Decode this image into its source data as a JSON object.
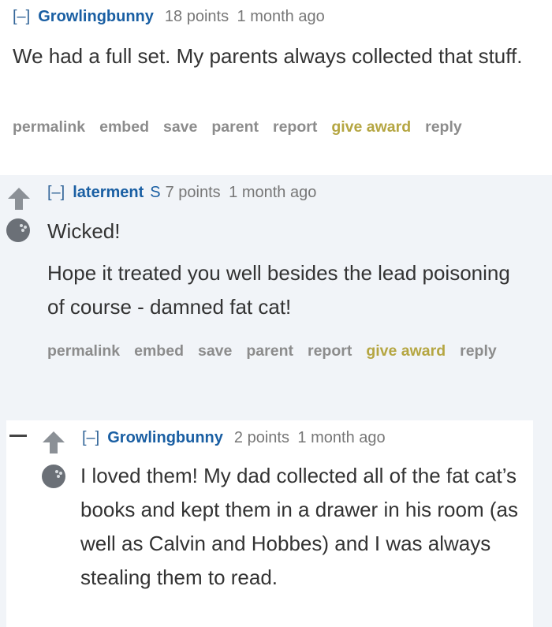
{
  "comments": [
    {
      "toggle": "[–]",
      "author": "Growlingbunny",
      "points": "18 points",
      "age": "1 month ago",
      "paragraphs": [
        "We had a full set. My parents always collected that stuff."
      ]
    },
    {
      "toggle": "[–]",
      "author": "laterment",
      "submitter_tag": "S",
      "points": "7 points",
      "age": "1 month ago",
      "paragraphs": [
        "Wicked!",
        "Hope it treated you well besides the lead poisoning of course - damned fat cat!"
      ]
    },
    {
      "toggle": "[–]",
      "author": "Growlingbunny",
      "points": "2 points",
      "age": "1 month ago",
      "paragraphs": [
        "I loved them! My dad collected all of the fat cat’s books and kept them in a drawer in his room (as well as Calvin and Hobbes) and I was always stealing them to read."
      ]
    }
  ],
  "actions": {
    "permalink": "permalink",
    "embed": "embed",
    "save": "save",
    "parent": "parent",
    "report": "report",
    "give_award": "give award",
    "reply": "reply"
  },
  "colors": {
    "author": "#1a5fa3",
    "award": "#b5a642",
    "nested_bg": "#f1f4f8"
  },
  "icons": [
    "upvote-arrow-icon",
    "bowling-ball-icon",
    "collapse-dash-icon"
  ]
}
